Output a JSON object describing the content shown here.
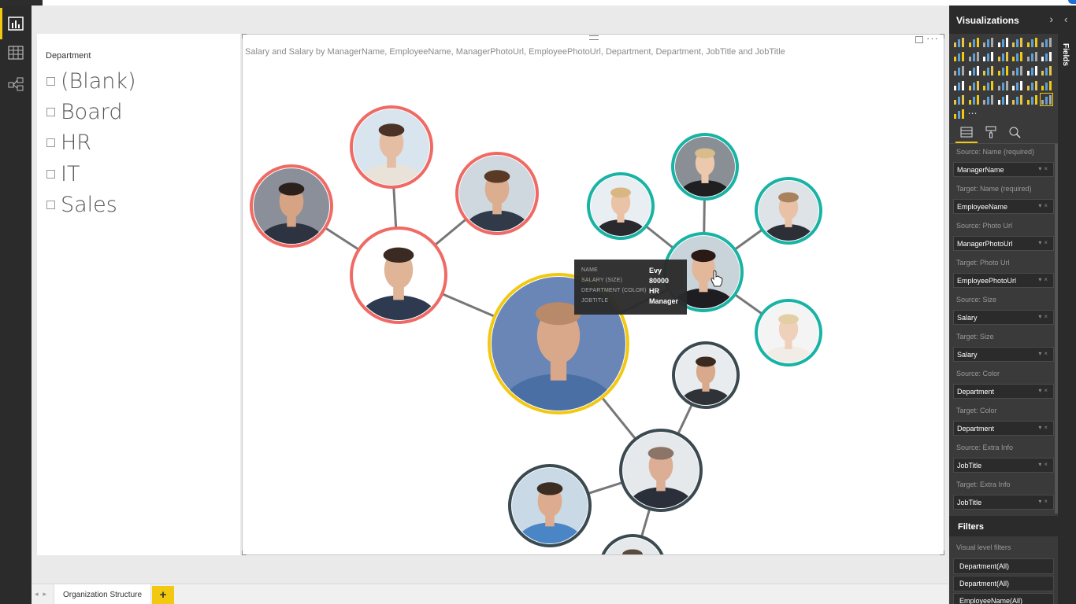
{
  "leftnav": {
    "items": [
      "report-view",
      "data-view",
      "relationships-view"
    ]
  },
  "slicer": {
    "title": "Department",
    "items": [
      "(Blank)",
      "Board",
      "HR",
      "IT",
      "Sales"
    ]
  },
  "visual": {
    "title": "Salary and Salary by ManagerName, EmployeeName, ManagerPhotoUrl, EmployeePhotoUrl, Department, Department, JobTitle and JobTitle",
    "colors": {
      "red": "#f06a65",
      "teal": "#18b3a4",
      "yellow": "#f2c811",
      "dark": "#3b4a50",
      "link": "#777777"
    }
  },
  "tooltip": {
    "rows": [
      {
        "key": "NAME",
        "value": "Evy"
      },
      {
        "key": "SALARY (SIZE)",
        "value": "80000"
      },
      {
        "key": "DEPARTMENT (COLOR)",
        "value": "HR"
      },
      {
        "key": "JOBTITLE",
        "value": "Manager"
      }
    ]
  },
  "tabs": {
    "page": "Organization Structure",
    "add": "+"
  },
  "viz_pane": {
    "title": "Visualizations",
    "wells": [
      {
        "label": "Source: Name (required)",
        "value": "ManagerName"
      },
      {
        "label": "Target: Name (required)",
        "value": "EmployeeName"
      },
      {
        "label": "Source: Photo Url",
        "value": "ManagerPhotoUrl"
      },
      {
        "label": "Target: Photo Url",
        "value": "EmployeePhotoUrl"
      },
      {
        "label": "Source: Size",
        "value": "Salary"
      },
      {
        "label": "Target: Size",
        "value": "Salary"
      },
      {
        "label": "Source: Color",
        "value": "Department"
      },
      {
        "label": "Target: Color",
        "value": "Department"
      },
      {
        "label": "Source: Extra Info",
        "value": "JobTitle"
      },
      {
        "label": "Target: Extra Info",
        "value": "JobTitle"
      }
    ],
    "filters_title": "Filters",
    "visual_level_filters": "Visual level filters",
    "filter_items": [
      "Department(All)",
      "Department(All)",
      "EmployeeName(All)"
    ]
  },
  "fields_pane": {
    "title": "Fields"
  }
}
